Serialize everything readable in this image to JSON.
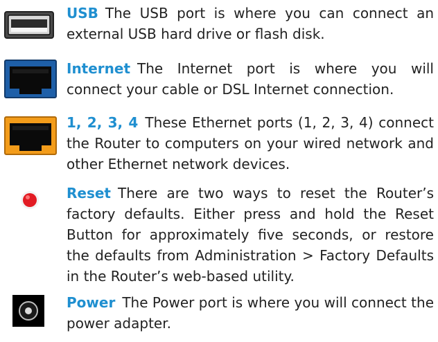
{
  "entries": [
    {
      "term": "USB",
      "icon": "usb-port-icon",
      "description": "The USB port is where you can connect an external USB hard drive or flash disk."
    },
    {
      "term": "Internet",
      "icon": "internet-port-icon",
      "description": "The Internet port is where you will connect your cable or DSL Internet connection."
    },
    {
      "term": "1, 2, 3, 4",
      "icon": "ethernet-port-icon",
      "description": "These Ethernet ports (1, 2, 3, 4) connect the Router to computers on your wired network and other Ethernet network devices."
    },
    {
      "term": "Reset",
      "icon": "reset-button-icon",
      "description": "There are two ways to reset the Router’s factory defaults. Either press and hold the Reset Button for approximately five seconds, or restore the defaults from Administration > Factory Defaults in the Router’s web-based utility."
    },
    {
      "term": "Power",
      "icon": "power-port-icon",
      "description": "The Power port is where you will connect the power adapter."
    }
  ],
  "colors": {
    "term": "#1f8fd0",
    "body_text": "#222222",
    "internet_port": "#1e5fa8",
    "ethernet_port": "#f39c1a",
    "reset_button": "#e21b23"
  }
}
